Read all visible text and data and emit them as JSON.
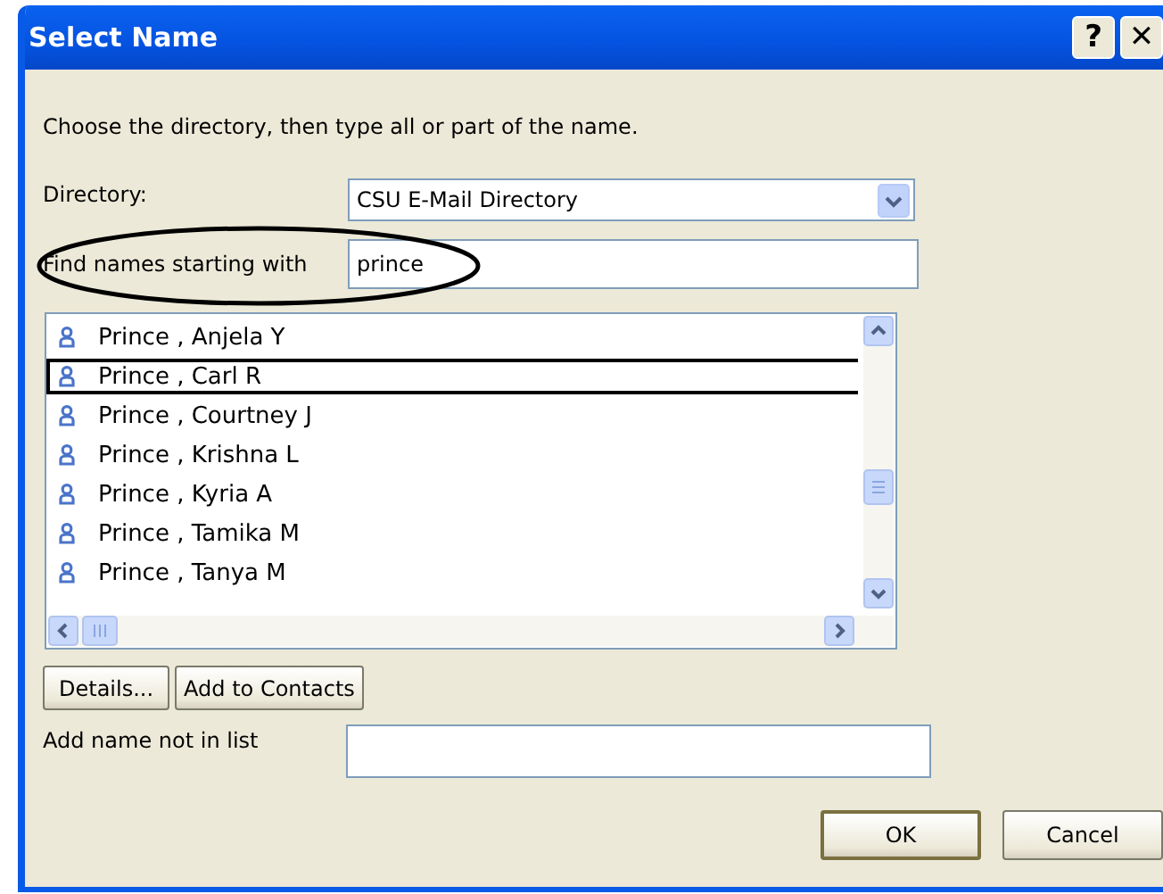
{
  "window": {
    "title": "Select Name",
    "help_button": "?",
    "close_button": "✕"
  },
  "instruction": "Choose the directory, then type all or part of the name.",
  "directory": {
    "label": "Directory:",
    "value": "CSU E-Mail Directory"
  },
  "find": {
    "label": "Find names starting with",
    "value": "prince"
  },
  "names": [
    {
      "name": "Prince , Anjela Y",
      "selected": false
    },
    {
      "name": "Prince , Carl R",
      "selected": true
    },
    {
      "name": "Prince , Courtney J",
      "selected": false
    },
    {
      "name": "Prince , Krishna L",
      "selected": false
    },
    {
      "name": "Prince , Kyria A",
      "selected": false
    },
    {
      "name": "Prince , Tamika M",
      "selected": false
    },
    {
      "name": "Prince , Tanya M",
      "selected": false
    }
  ],
  "list_buttons": [
    "Details...",
    "Add to Contacts"
  ],
  "add_name": {
    "label": "Add name not in list"
  },
  "buttons": [
    "OK",
    "Cancel"
  ]
}
